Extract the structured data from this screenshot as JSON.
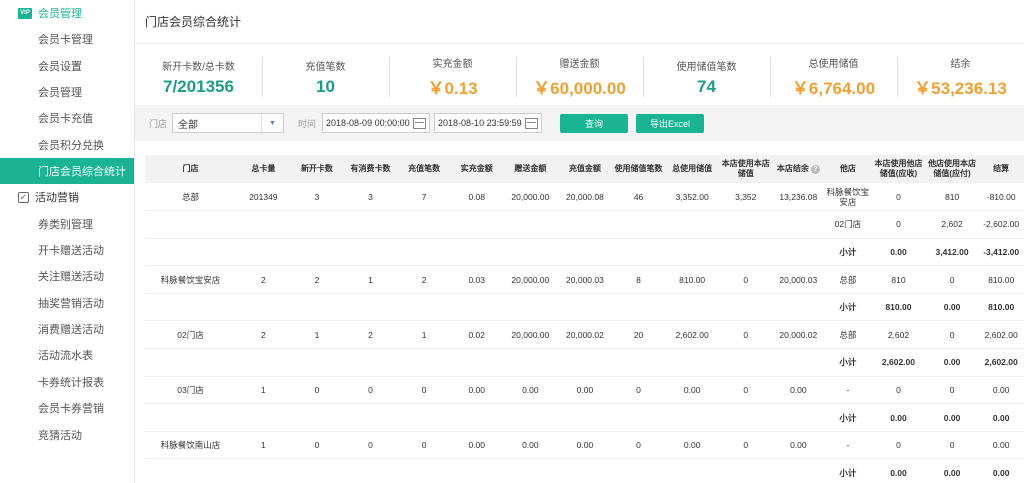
{
  "sidebar": {
    "sections": [
      {
        "title": "会员管理",
        "icon_text": "VIP",
        "items": [
          {
            "label": "会员卡管理",
            "active": false
          },
          {
            "label": "会员设置",
            "active": false
          },
          {
            "label": "会员管理",
            "active": false
          },
          {
            "label": "会员卡充值",
            "active": false
          },
          {
            "label": "会员积分兑换",
            "active": false
          },
          {
            "label": "门店会员综合统计",
            "active": true
          }
        ]
      },
      {
        "title": "活动营销",
        "items": [
          {
            "label": "券类别管理",
            "active": false
          },
          {
            "label": "开卡赠送活动",
            "active": false
          },
          {
            "label": "关注赠送活动",
            "active": false
          },
          {
            "label": "抽奖营销活动",
            "active": false
          },
          {
            "label": "消费赠送活动",
            "active": false
          },
          {
            "label": "活动流水表",
            "active": false
          },
          {
            "label": "卡券统计报表",
            "active": false
          },
          {
            "label": "会员卡券营销",
            "active": false
          },
          {
            "label": "竞猜活动",
            "active": false
          }
        ]
      }
    ]
  },
  "page": {
    "title": "门店会员综合统计"
  },
  "stats": [
    {
      "label": "新开卡数/总卡数",
      "value": "7/201356",
      "color": "green"
    },
    {
      "label": "充值笔数",
      "value": "10",
      "color": "green"
    },
    {
      "label": "实充金额",
      "value": "￥0.13",
      "color": "orange"
    },
    {
      "label": "赠送金额",
      "value": "￥60,000.00",
      "color": "orange"
    },
    {
      "label": "使用储值笔数",
      "value": "74",
      "color": "green"
    },
    {
      "label": "总使用储值",
      "value": "￥6,764.00",
      "color": "orange"
    },
    {
      "label": "结余",
      "value": "￥53,236.13",
      "color": "orange"
    }
  ],
  "filter": {
    "store_label": "门店",
    "store_value": "全部",
    "time_label": "时间",
    "start_time": "2018-08-09 00:00:00",
    "end_time": "2018-08-10 23:59:59",
    "query_label": "查询",
    "export_label": "导出Excel"
  },
  "table": {
    "headers": [
      "门店",
      "总卡量",
      "新开卡数",
      "有消费卡数",
      "充值笔数",
      "实充金额",
      "赠送金额",
      "充值金额",
      "使用储值笔数",
      "总使用储值",
      "本店使用本店储值",
      "本店结余",
      "他店",
      "本店使用他店储值(应收)",
      "他店使用本店储值(应付)",
      "结算"
    ],
    "rows": [
      {
        "cells": [
          "总部",
          "201349",
          "3",
          "3",
          "7",
          "0.08",
          "20,000.00",
          "20,000.08",
          "46",
          "3,352.00",
          "3,352",
          "13,236.08",
          "科脉餐饮宝安店",
          "0",
          "810",
          "-810.00"
        ],
        "bold": false
      },
      {
        "cells": [
          "",
          "",
          "",
          "",
          "",
          "",
          "",
          "",
          "",
          "",
          "",
          "",
          "02门店",
          "0",
          "2,602",
          "-2,602.00"
        ],
        "bold": false
      },
      {
        "cells": [
          "",
          "",
          "",
          "",
          "",
          "",
          "",
          "",
          "",
          "",
          "",
          "",
          "小计",
          "0.00",
          "3,412.00",
          "-3,412.00"
        ],
        "bold": true
      },
      {
        "cells": [
          "科脉餐饮宝安店",
          "2",
          "2",
          "1",
          "2",
          "0.03",
          "20,000.00",
          "20,000.03",
          "8",
          "810.00",
          "0",
          "20,000.03",
          "总部",
          "810",
          "0",
          "810.00"
        ],
        "bold": false
      },
      {
        "cells": [
          "",
          "",
          "",
          "",
          "",
          "",
          "",
          "",
          "",
          "",
          "",
          "",
          "小计",
          "810.00",
          "0.00",
          "810.00"
        ],
        "bold": true
      },
      {
        "cells": [
          "02门店",
          "2",
          "1",
          "2",
          "1",
          "0.02",
          "20,000.00",
          "20,000.02",
          "20",
          "2,602.00",
          "0",
          "20,000.02",
          "总部",
          "2,602",
          "0",
          "2,602.00"
        ],
        "bold": false
      },
      {
        "cells": [
          "",
          "",
          "",
          "",
          "",
          "",
          "",
          "",
          "",
          "",
          "",
          "",
          "小计",
          "2,602.00",
          "0.00",
          "2,602.00"
        ],
        "bold": true
      },
      {
        "cells": [
          "03门店",
          "1",
          "0",
          "0",
          "0",
          "0.00",
          "0.00",
          "0.00",
          "0",
          "0.00",
          "0",
          "0.00",
          "-",
          "0",
          "0",
          "0.00"
        ],
        "bold": false
      },
      {
        "cells": [
          "",
          "",
          "",
          "",
          "",
          "",
          "",
          "",
          "",
          "",
          "",
          "",
          "小计",
          "0.00",
          "0.00",
          "0.00"
        ],
        "bold": true
      },
      {
        "cells": [
          "科脉餐饮南山店",
          "1",
          "0",
          "0",
          "0",
          "0.00",
          "0.00",
          "0.00",
          "0",
          "0.00",
          "0",
          "0.00",
          "-",
          "0",
          "0",
          "0.00"
        ],
        "bold": false
      },
      {
        "cells": [
          "",
          "",
          "",
          "",
          "",
          "",
          "",
          "",
          "",
          "",
          "",
          "",
          "小计",
          "0.00",
          "0.00",
          "0.00"
        ],
        "bold": true
      }
    ]
  }
}
